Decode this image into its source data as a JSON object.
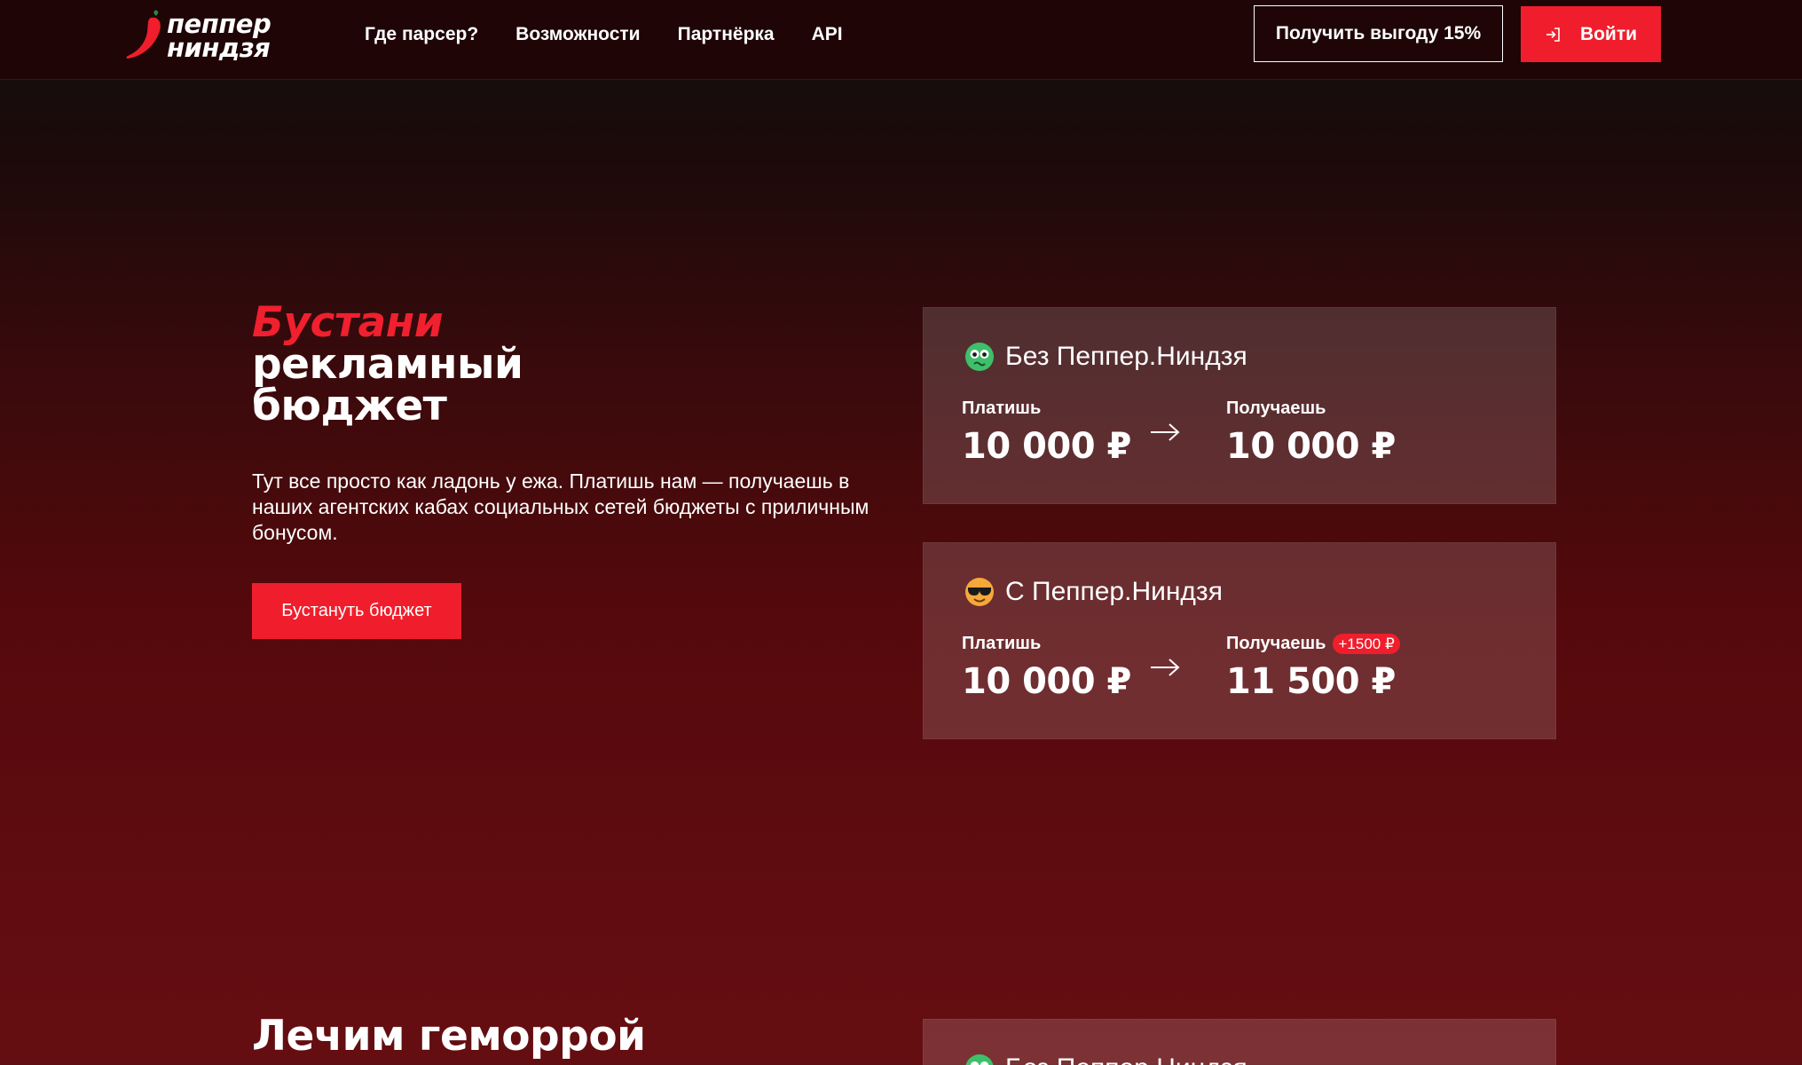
{
  "brand": {
    "logo_line1": "пеппер",
    "logo_line2": "ниндзя",
    "accent_color": "#f01e2c"
  },
  "nav": {
    "items": [
      {
        "label": "Где парсер?"
      },
      {
        "label": "Возможности"
      },
      {
        "label": "Партнёрка"
      },
      {
        "label": "API"
      }
    ]
  },
  "header": {
    "promo_label": "Получить выгоду 15%",
    "login_label": "Войти",
    "login_icon": "login-icon"
  },
  "hero": {
    "title_accent": "Бустани",
    "title_line1": "рекламный",
    "title_line2": "бюджет",
    "description": "Тут все просто как ладонь у ежа. Платишь нам — получаешь в наших агентских кабах социальных сетей бюджеты с приличным бонусом.",
    "cta_label": "Бустануть бюджет"
  },
  "cards": [
    {
      "title": "Без Пеппер.Ниндзя",
      "emoji": "sick-face-emoji",
      "pay_label": "Платишь",
      "pay_value": "10 000 ₽",
      "get_label": "Получаешь",
      "get_value": "10 000 ₽"
    },
    {
      "title": "С Пеппер.Ниндзя",
      "emoji": "sunglasses-face-emoji",
      "pay_label": "Платишь",
      "pay_value": "10 000 ₽",
      "get_label": "Получаешь",
      "bonus": "+1500 ₽",
      "get_value": "11 500 ₽"
    }
  ],
  "section2": {
    "title": "Лечим геморрой"
  }
}
